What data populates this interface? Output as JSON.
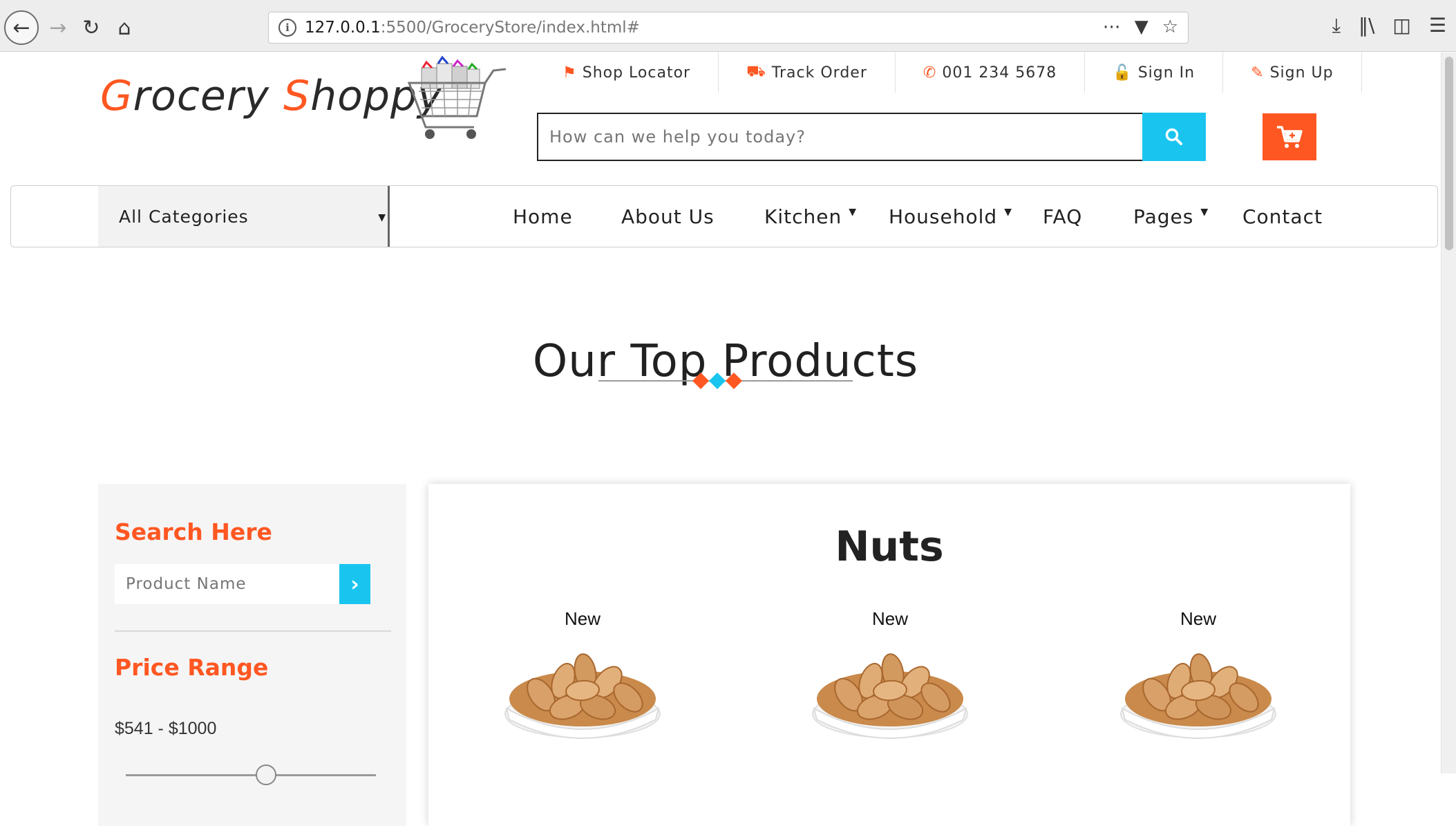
{
  "browser": {
    "url_host": "127.0.0.1",
    "url_path": ":5500/GroceryStore/index.html#"
  },
  "site": {
    "logo_first_initial": "G",
    "logo_first_rest": "rocery ",
    "logo_second_initial": "S",
    "logo_second_rest": "hoppy",
    "top_links": [
      {
        "label": "Shop Locator"
      },
      {
        "label": "Track Order"
      },
      {
        "label": "001 234 5678"
      },
      {
        "label": "Sign In"
      },
      {
        "label": "Sign Up"
      }
    ],
    "search_placeholder": "How can we help you today?"
  },
  "navbar": {
    "category_selected": "All Categories",
    "menu": [
      {
        "label": "Home",
        "dropdown": false
      },
      {
        "label": "About Us",
        "dropdown": false
      },
      {
        "label": "Kitchen",
        "dropdown": true
      },
      {
        "label": "Household",
        "dropdown": true
      },
      {
        "label": "FAQ",
        "dropdown": false
      },
      {
        "label": "Pages",
        "dropdown": true
      },
      {
        "label": "Contact",
        "dropdown": false
      }
    ]
  },
  "section": {
    "title": "Our Top Products"
  },
  "sidebar": {
    "search_heading": "Search Here",
    "search_placeholder": "Product Name",
    "price_heading": "Price Range",
    "price_text": "$541 - $1000",
    "price_slider_fraction": 0.56
  },
  "panel": {
    "title": "Nuts",
    "products": [
      {
        "badge": "New"
      },
      {
        "badge": "New"
      },
      {
        "badge": "New"
      }
    ]
  },
  "colors": {
    "accent_orange": "#ff5722",
    "accent_cyan": "#19c5ee"
  }
}
